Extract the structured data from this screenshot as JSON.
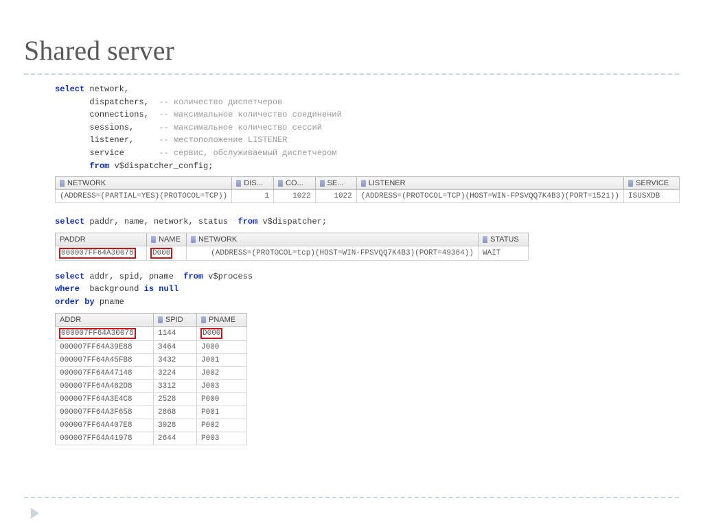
{
  "title": "Shared server",
  "sql1": {
    "select": "select",
    "fields": {
      "network": {
        "name": "network,",
        "cmt": ""
      },
      "dispatchers": {
        "name": "dispatchers,",
        "cmt": "-- количество диспетчеров"
      },
      "connections": {
        "name": "connections,",
        "cmt": "-- максимальное количество соединений"
      },
      "sessions": {
        "name": "sessions,",
        "cmt": "-- максимальное количество сессий"
      },
      "listener": {
        "name": "listener,",
        "cmt": "-- местоположение LISTENER"
      },
      "service": {
        "name": "service",
        "cmt": "-- сервис, обслуживаемый диспетчером"
      }
    },
    "from": "from",
    "table": "v$dispatcher_config;"
  },
  "grid1": {
    "headers": {
      "network": "NETWORK",
      "dis": "DIS...",
      "co": "CO...",
      "se": "SE...",
      "listener": "LISTENER",
      "service": "SERVICE"
    },
    "row": {
      "network": "(ADDRESS=(PARTIAL=YES)(PROTOCOL=TCP))",
      "dis": "1",
      "co": "1022",
      "se": "1022",
      "listener": "(ADDRESS=(PROTOCOL=TCP)(HOST=WIN-FPSVQQ7K4B3)(PORT=1521))",
      "service": "ISUSXDB"
    }
  },
  "sql2": {
    "select": "select",
    "body": "paddr, name, network, status",
    "from": "from",
    "table": "v$dispatcher;"
  },
  "grid2": {
    "headers": {
      "paddr": "PADDR",
      "name": "NAME",
      "network": "NETWORK",
      "status": "STATUS"
    },
    "row": {
      "paddr": "000007FF64A30078",
      "name": "D000",
      "network": "(ADDRESS=(PROTOCOL=tcp)(HOST=WIN-FPSVQQ7K4B3)(PORT=49364))",
      "status": "WAIT"
    }
  },
  "sql3": {
    "select": "select",
    "body": "addr, spid, pname",
    "from": "from",
    "table": "v$process",
    "where": "where",
    "cond1": "background",
    "is": "is",
    "null": "null",
    "order": "order by",
    "ordcol": "pname"
  },
  "grid3": {
    "headers": {
      "addr": "ADDR",
      "spid": "SPID",
      "pname": "PNAME"
    },
    "rows": [
      {
        "addr": "000007FF64A30078",
        "spid": "1144",
        "pname": "D000",
        "hl": true
      },
      {
        "addr": "000007FF64A39E88",
        "spid": "3464",
        "pname": "J000"
      },
      {
        "addr": "000007FF64A45FB8",
        "spid": "3432",
        "pname": "J001"
      },
      {
        "addr": "000007FF64A47148",
        "spid": "3224",
        "pname": "J002"
      },
      {
        "addr": "000007FF64A482D8",
        "spid": "3312",
        "pname": "J003"
      },
      {
        "addr": "000007FF64A3E4C8",
        "spid": "2528",
        "pname": "P000"
      },
      {
        "addr": "000007FF64A3F658",
        "spid": "2868",
        "pname": "P001"
      },
      {
        "addr": "000007FF64A407E8",
        "spid": "3028",
        "pname": "P002"
      },
      {
        "addr": "000007FF64A41978",
        "spid": "2644",
        "pname": "P003"
      }
    ]
  }
}
